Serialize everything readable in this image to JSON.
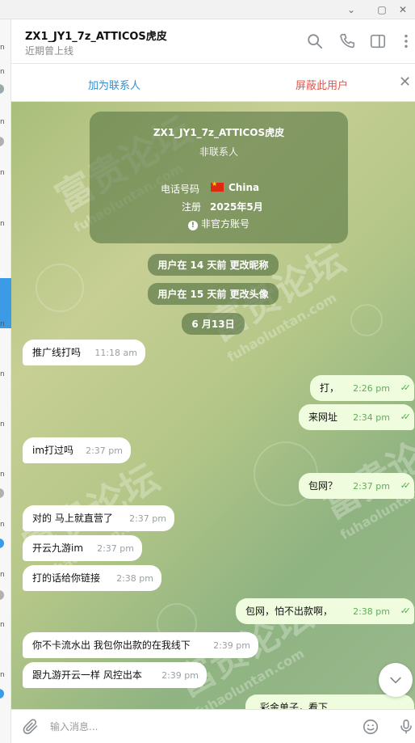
{
  "window": {
    "minimize": "⌄",
    "restore": "▢",
    "close": "✕"
  },
  "left_strip": {
    "marks": [
      "n",
      "n",
      "n",
      "n",
      "n",
      "n",
      "n",
      "n",
      "n",
      "n",
      "n",
      "n",
      "n",
      "n"
    ]
  },
  "header": {
    "title": "ZX1_JY1_7z_ATTICOS虎皮",
    "status": "近期曾上线"
  },
  "action_bar": {
    "add_contact": "加为联系人",
    "block_user": "屏蔽此用户",
    "close": "✕"
  },
  "info_card": {
    "name": "ZX1_JY1_7z_ATTICOS虎皮",
    "subtitle": "非联系人",
    "phone_label": "电话号码",
    "phone_value": "China",
    "reg_label": "注册",
    "reg_value": "2025年5月",
    "official_icon": "!",
    "official": "非官方账号"
  },
  "service": {
    "nickname": "用户在 14 天前 更改昵称",
    "avatar": "用户在 15 天前 更改头像",
    "date": "6 月13日"
  },
  "watermark": {
    "text": "富贵论坛",
    "url": "fuhaoluntan.com"
  },
  "messages": [
    {
      "text": "推广线打吗",
      "time": "11:18 am",
      "dir": "in"
    },
    {
      "text": "打，",
      "time": "2:26 pm",
      "dir": "out"
    },
    {
      "text": "来网址",
      "time": "2:34 pm",
      "dir": "out"
    },
    {
      "text": "im打过吗",
      "time": "2:37 pm",
      "dir": "in"
    },
    {
      "text": "包网？",
      "time": "2:37 pm",
      "dir": "out"
    },
    {
      "text": "对的 马上就直营了",
      "time": "2:37 pm",
      "dir": "in"
    },
    {
      "text": "开云九游im",
      "time": "2:37 pm",
      "dir": "in"
    },
    {
      "text": "打的话给你链接",
      "time": "2:38 pm",
      "dir": "in"
    },
    {
      "text": "包网，怕不出款啊，",
      "time": "2:38 pm",
      "dir": "out"
    },
    {
      "text": "你不卡流水出 我包你出款的在我线下",
      "time": "2:39 pm",
      "dir": "in"
    },
    {
      "text": "跟九游开云一样 风控出本",
      "time": "2:39 pm",
      "dir": "in"
    },
    {
      "text": "彩金单子，看下",
      "time": "",
      "dir": "out"
    }
  ],
  "input": {
    "placeholder": "输入消息..."
  },
  "colors": {
    "accent": "#3390d0",
    "danger": "#e0574f",
    "outgoing": "#effdde",
    "tick": "#4fae4e"
  }
}
